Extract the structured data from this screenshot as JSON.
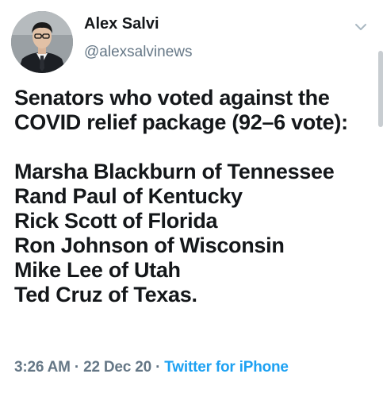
{
  "tweet": {
    "display_name": "Alex Salvi",
    "handle": "@alexsalvinews",
    "text_lines": [
      "Senators who voted against the",
      "COVID relief package (92–6 vote):"
    ],
    "senators": [
      "Marsha Blackburn of Tennessee",
      "Rand Paul of Kentucky",
      "Rick Scott of Florida",
      "Ron Johnson of Wisconsin",
      "Mike Lee of Utah",
      "Ted Cruz of Texas."
    ],
    "time": "3:26 AM",
    "separator": "·",
    "date": "22 Dec 20",
    "source": "Twitter for iPhone"
  },
  "icons": {
    "menu": "chevron-down-icon",
    "avatar": "avatar"
  },
  "colors": {
    "text": "#14171a",
    "secondary": "#657786",
    "link": "#1da1f2"
  }
}
